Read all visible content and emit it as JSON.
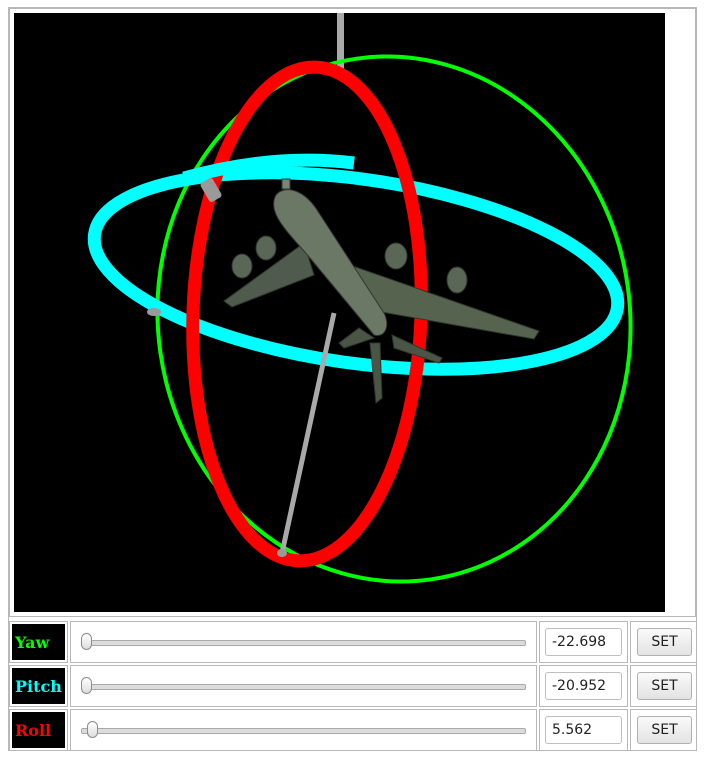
{
  "controls": [
    {
      "key": "yaw",
      "label": "Yaw",
      "color": "#00ff00",
      "value": "-22.698",
      "slider_fraction": 0.015,
      "button": "SET"
    },
    {
      "key": "pitch",
      "label": "Pitch",
      "color": "#00ffff",
      "value": "-20.952",
      "slider_fraction": 0.015,
      "button": "SET"
    },
    {
      "key": "roll",
      "label": "Roll",
      "color": "#ff0000",
      "value": "5.562",
      "slider_fraction": 0.03,
      "button": "SET"
    }
  ],
  "scene": {
    "background": "#000000",
    "yaw_ring_color": "#00ff00",
    "pitch_ring_color": "#00ffff",
    "roll_ring_color": "#ff0000",
    "axis_color": "#a0a0a0",
    "model": "airplane-model"
  }
}
